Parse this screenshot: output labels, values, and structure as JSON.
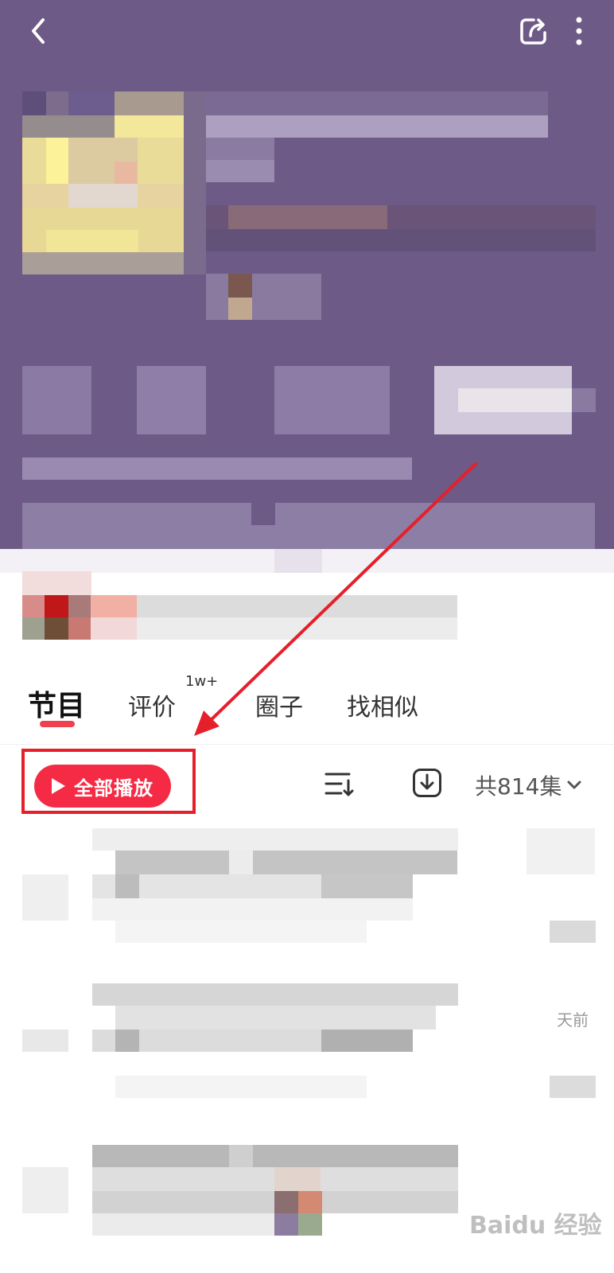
{
  "topbar": {
    "back_icon": "chevron-left-icon",
    "share_icon": "share-icon",
    "more_icon": "more-vertical-icon"
  },
  "tabs": [
    {
      "label": "节目",
      "active": true
    },
    {
      "label": "评价",
      "badge": "1w+"
    },
    {
      "label": "圈子"
    },
    {
      "label": "找相似"
    }
  ],
  "toolbar": {
    "play_all_label": "全部播放",
    "sort_icon": "sort-icon",
    "download_icon": "download-icon",
    "episode_count": "共814集",
    "dropdown_icon": "chevron-down-icon"
  },
  "list": {
    "time_fragment": "天前"
  },
  "watermark": "Baidu 经验",
  "colors": {
    "header_bg": "#6e5a86",
    "accent": "#f52b45",
    "annotation": "#e5202a"
  }
}
